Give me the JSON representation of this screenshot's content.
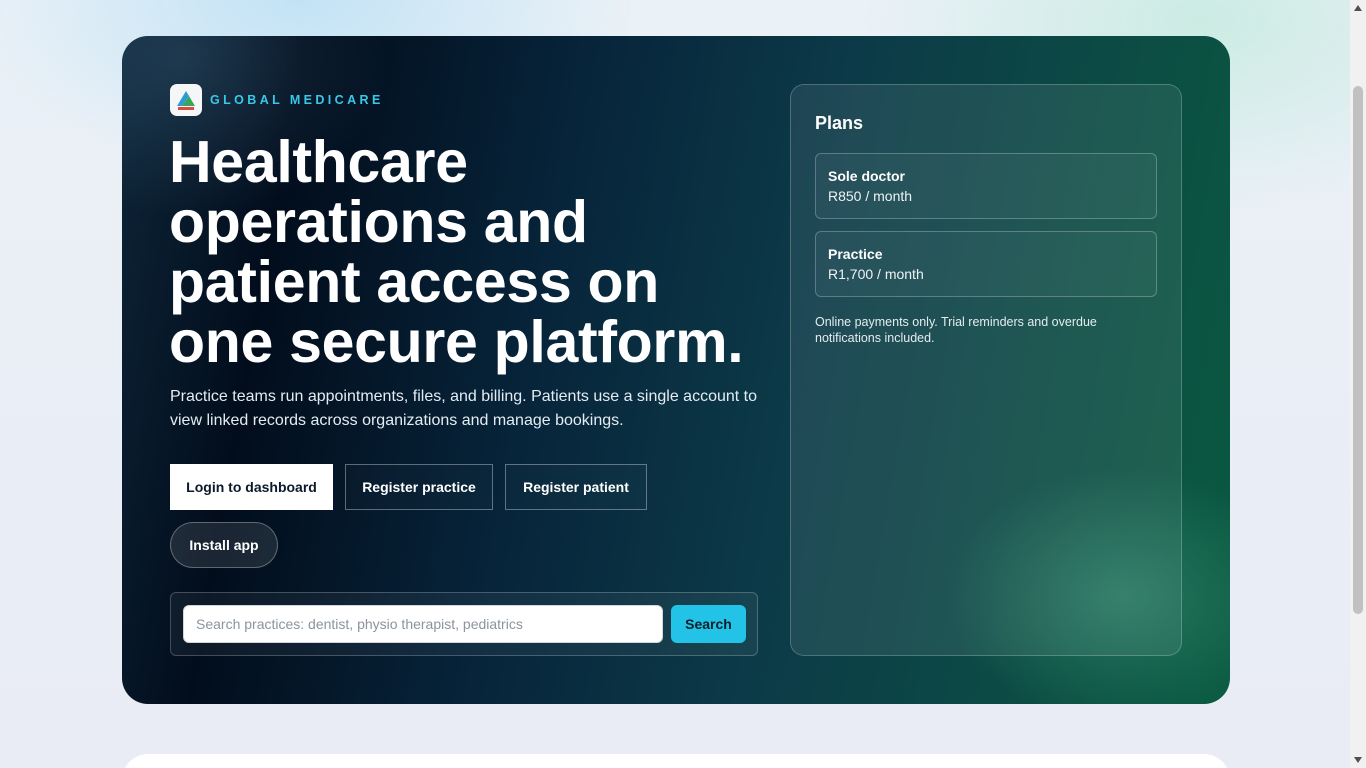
{
  "brand": {
    "name": "GLOBAL MEDICARE",
    "logo_icon": "triangle-logo-icon"
  },
  "hero": {
    "headline": "Healthcare operations and patient access on one secure platform.",
    "subtitle": "Practice teams run appointments, files, and billing. Patients use a single account to view linked records across organizations and manage bookings."
  },
  "actions": {
    "login": "Login to dashboard",
    "register_practice": "Register practice",
    "register_patient": "Register patient",
    "install": "Install app"
  },
  "search": {
    "placeholder": "Search practices: dentist, physio therapist, pediatrics",
    "value": "",
    "button": "Search"
  },
  "plans": {
    "title": "Plans",
    "items": [
      {
        "name": "Sole doctor",
        "price": "R850 / month"
      },
      {
        "name": "Practice",
        "price": "R1,700 / month"
      }
    ],
    "note": "Online payments only. Trial reminders and overdue notifications included."
  },
  "colors": {
    "accent": "#22c3e6",
    "brand_text": "#39c8e6",
    "hero_dark": "#020d1c",
    "hero_green": "#0a5a40"
  }
}
